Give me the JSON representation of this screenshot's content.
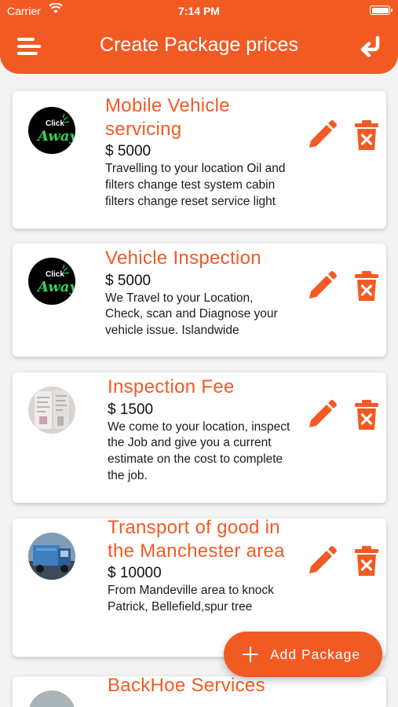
{
  "status_bar": {
    "carrier": "Carrier",
    "time": "7:14 PM"
  },
  "header": {
    "title": "Create Package prices"
  },
  "packages": [
    {
      "title": "Mobile Vehicle servicing",
      "price": "$ 5000",
      "description": "Travelling to your location Oil and filters change test system cabin filters change reset service light",
      "avatar": "click-away-logo",
      "logo_text_top": "Click",
      "logo_text_bottom": "Away"
    },
    {
      "title": "Vehicle Inspection",
      "price": "$ 5000",
      "description": "We Travel to your Location, Check, scan and Diagnose your vehicle issue. Islandwide",
      "avatar": "click-away-logo",
      "logo_text_top": "Click",
      "logo_text_bottom": "Away"
    },
    {
      "title": "Inspection Fee",
      "price": "$ 1500",
      "description": "We come to your location, inspect the Job and give you a current estimate on the cost to complete the job.",
      "avatar": "document-photo"
    },
    {
      "title": "Transport of good in the Manchester area",
      "price": "$ 10000",
      "description": "From Mandeville area to knock Patrick, Bellefield,spur tree",
      "avatar": "truck-photo"
    },
    {
      "title": "BackHoe Services",
      "avatar": "backhoe-photo"
    }
  ],
  "actions": {
    "edit_icon": "pencil-icon",
    "delete_icon": "trash-icon"
  },
  "fab": {
    "label": "Add Package"
  },
  "colors": {
    "accent": "#f25a23",
    "logo_green": "#2fd35a"
  }
}
